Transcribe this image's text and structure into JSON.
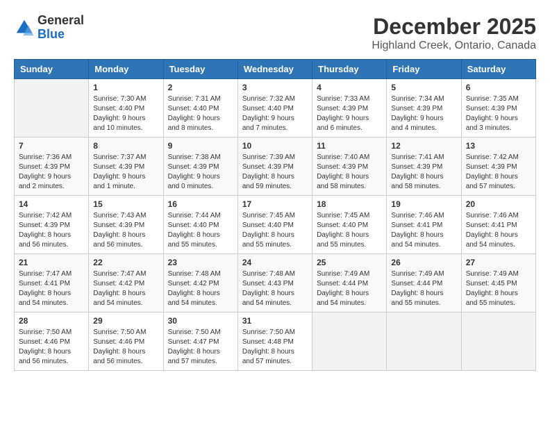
{
  "logo": {
    "general": "General",
    "blue": "Blue"
  },
  "title": "December 2025",
  "subtitle": "Highland Creek, Ontario, Canada",
  "days_of_week": [
    "Sunday",
    "Monday",
    "Tuesday",
    "Wednesday",
    "Thursday",
    "Friday",
    "Saturday"
  ],
  "weeks": [
    [
      {
        "day": "",
        "sunrise": "",
        "sunset": "",
        "daylight": "",
        "empty": true
      },
      {
        "day": "1",
        "sunrise": "Sunrise: 7:30 AM",
        "sunset": "Sunset: 4:40 PM",
        "daylight": "Daylight: 9 hours and 10 minutes.",
        "empty": false
      },
      {
        "day": "2",
        "sunrise": "Sunrise: 7:31 AM",
        "sunset": "Sunset: 4:40 PM",
        "daylight": "Daylight: 9 hours and 8 minutes.",
        "empty": false
      },
      {
        "day": "3",
        "sunrise": "Sunrise: 7:32 AM",
        "sunset": "Sunset: 4:40 PM",
        "daylight": "Daylight: 9 hours and 7 minutes.",
        "empty": false
      },
      {
        "day": "4",
        "sunrise": "Sunrise: 7:33 AM",
        "sunset": "Sunset: 4:39 PM",
        "daylight": "Daylight: 9 hours and 6 minutes.",
        "empty": false
      },
      {
        "day": "5",
        "sunrise": "Sunrise: 7:34 AM",
        "sunset": "Sunset: 4:39 PM",
        "daylight": "Daylight: 9 hours and 4 minutes.",
        "empty": false
      },
      {
        "day": "6",
        "sunrise": "Sunrise: 7:35 AM",
        "sunset": "Sunset: 4:39 PM",
        "daylight": "Daylight: 9 hours and 3 minutes.",
        "empty": false
      }
    ],
    [
      {
        "day": "7",
        "sunrise": "Sunrise: 7:36 AM",
        "sunset": "Sunset: 4:39 PM",
        "daylight": "Daylight: 9 hours and 2 minutes.",
        "empty": false
      },
      {
        "day": "8",
        "sunrise": "Sunrise: 7:37 AM",
        "sunset": "Sunset: 4:39 PM",
        "daylight": "Daylight: 9 hours and 1 minute.",
        "empty": false
      },
      {
        "day": "9",
        "sunrise": "Sunrise: 7:38 AM",
        "sunset": "Sunset: 4:39 PM",
        "daylight": "Daylight: 9 hours and 0 minutes.",
        "empty": false
      },
      {
        "day": "10",
        "sunrise": "Sunrise: 7:39 AM",
        "sunset": "Sunset: 4:39 PM",
        "daylight": "Daylight: 8 hours and 59 minutes.",
        "empty": false
      },
      {
        "day": "11",
        "sunrise": "Sunrise: 7:40 AM",
        "sunset": "Sunset: 4:39 PM",
        "daylight": "Daylight: 8 hours and 58 minutes.",
        "empty": false
      },
      {
        "day": "12",
        "sunrise": "Sunrise: 7:41 AM",
        "sunset": "Sunset: 4:39 PM",
        "daylight": "Daylight: 8 hours and 58 minutes.",
        "empty": false
      },
      {
        "day": "13",
        "sunrise": "Sunrise: 7:42 AM",
        "sunset": "Sunset: 4:39 PM",
        "daylight": "Daylight: 8 hours and 57 minutes.",
        "empty": false
      }
    ],
    [
      {
        "day": "14",
        "sunrise": "Sunrise: 7:42 AM",
        "sunset": "Sunset: 4:39 PM",
        "daylight": "Daylight: 8 hours and 56 minutes.",
        "empty": false
      },
      {
        "day": "15",
        "sunrise": "Sunrise: 7:43 AM",
        "sunset": "Sunset: 4:39 PM",
        "daylight": "Daylight: 8 hours and 56 minutes.",
        "empty": false
      },
      {
        "day": "16",
        "sunrise": "Sunrise: 7:44 AM",
        "sunset": "Sunset: 4:40 PM",
        "daylight": "Daylight: 8 hours and 55 minutes.",
        "empty": false
      },
      {
        "day": "17",
        "sunrise": "Sunrise: 7:45 AM",
        "sunset": "Sunset: 4:40 PM",
        "daylight": "Daylight: 8 hours and 55 minutes.",
        "empty": false
      },
      {
        "day": "18",
        "sunrise": "Sunrise: 7:45 AM",
        "sunset": "Sunset: 4:40 PM",
        "daylight": "Daylight: 8 hours and 55 minutes.",
        "empty": false
      },
      {
        "day": "19",
        "sunrise": "Sunrise: 7:46 AM",
        "sunset": "Sunset: 4:41 PM",
        "daylight": "Daylight: 8 hours and 54 minutes.",
        "empty": false
      },
      {
        "day": "20",
        "sunrise": "Sunrise: 7:46 AM",
        "sunset": "Sunset: 4:41 PM",
        "daylight": "Daylight: 8 hours and 54 minutes.",
        "empty": false
      }
    ],
    [
      {
        "day": "21",
        "sunrise": "Sunrise: 7:47 AM",
        "sunset": "Sunset: 4:41 PM",
        "daylight": "Daylight: 8 hours and 54 minutes.",
        "empty": false
      },
      {
        "day": "22",
        "sunrise": "Sunrise: 7:47 AM",
        "sunset": "Sunset: 4:42 PM",
        "daylight": "Daylight: 8 hours and 54 minutes.",
        "empty": false
      },
      {
        "day": "23",
        "sunrise": "Sunrise: 7:48 AM",
        "sunset": "Sunset: 4:42 PM",
        "daylight": "Daylight: 8 hours and 54 minutes.",
        "empty": false
      },
      {
        "day": "24",
        "sunrise": "Sunrise: 7:48 AM",
        "sunset": "Sunset: 4:43 PM",
        "daylight": "Daylight: 8 hours and 54 minutes.",
        "empty": false
      },
      {
        "day": "25",
        "sunrise": "Sunrise: 7:49 AM",
        "sunset": "Sunset: 4:44 PM",
        "daylight": "Daylight: 8 hours and 54 minutes.",
        "empty": false
      },
      {
        "day": "26",
        "sunrise": "Sunrise: 7:49 AM",
        "sunset": "Sunset: 4:44 PM",
        "daylight": "Daylight: 8 hours and 55 minutes.",
        "empty": false
      },
      {
        "day": "27",
        "sunrise": "Sunrise: 7:49 AM",
        "sunset": "Sunset: 4:45 PM",
        "daylight": "Daylight: 8 hours and 55 minutes.",
        "empty": false
      }
    ],
    [
      {
        "day": "28",
        "sunrise": "Sunrise: 7:50 AM",
        "sunset": "Sunset: 4:46 PM",
        "daylight": "Daylight: 8 hours and 56 minutes.",
        "empty": false
      },
      {
        "day": "29",
        "sunrise": "Sunrise: 7:50 AM",
        "sunset": "Sunset: 4:46 PM",
        "daylight": "Daylight: 8 hours and 56 minutes.",
        "empty": false
      },
      {
        "day": "30",
        "sunrise": "Sunrise: 7:50 AM",
        "sunset": "Sunset: 4:47 PM",
        "daylight": "Daylight: 8 hours and 57 minutes.",
        "empty": false
      },
      {
        "day": "31",
        "sunrise": "Sunrise: 7:50 AM",
        "sunset": "Sunset: 4:48 PM",
        "daylight": "Daylight: 8 hours and 57 minutes.",
        "empty": false
      },
      {
        "day": "",
        "sunrise": "",
        "sunset": "",
        "daylight": "",
        "empty": true
      },
      {
        "day": "",
        "sunrise": "",
        "sunset": "",
        "daylight": "",
        "empty": true
      },
      {
        "day": "",
        "sunrise": "",
        "sunset": "",
        "daylight": "",
        "empty": true
      }
    ]
  ]
}
